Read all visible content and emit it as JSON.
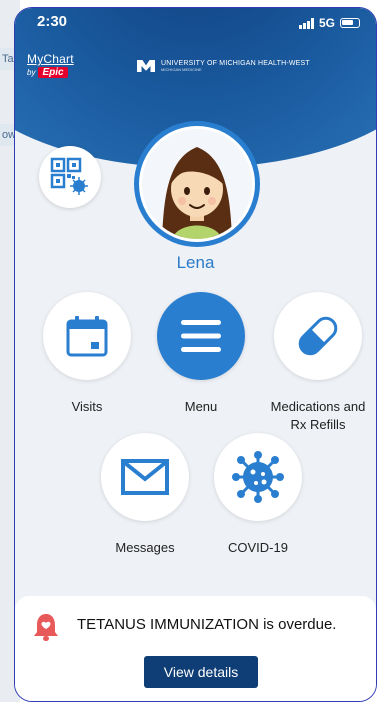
{
  "background_page": {
    "tab_top": "Ta",
    "tab_bottom": "ow"
  },
  "status_bar": {
    "time": "2:30",
    "network": "5G"
  },
  "header": {
    "mychart_word": "MyChart",
    "by_label": "by",
    "epic_label": "Epic",
    "org_name": "UNIVERSITY OF MICHIGAN HEALTH-WEST",
    "org_sub": "MICHIGAN MEDICINE"
  },
  "profile": {
    "name": "Lena"
  },
  "tiles": {
    "visits": "Visits",
    "menu": "Menu",
    "medications_line1": "Medications and",
    "medications_line2": "Rx Refills",
    "messages": "Messages",
    "covid": "COVID-19"
  },
  "notification": {
    "text": "TETANUS IMMUNIZATION is overdue.",
    "button": "View details"
  },
  "colors": {
    "brand_blue": "#2a7ed0",
    "header_dark": "#0f3d75",
    "epic_red": "#e4002b",
    "alert_red": "#e85a5a"
  }
}
